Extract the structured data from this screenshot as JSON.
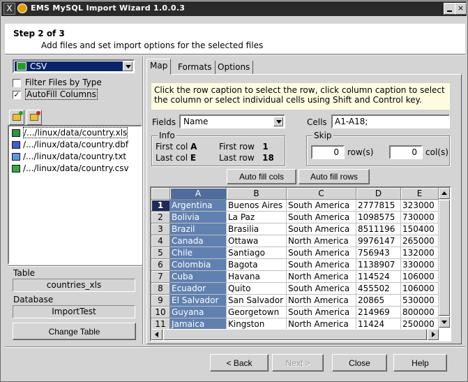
{
  "window": {
    "title": "EMS MySQL Import Wizard 1.0.0.3",
    "close_glyph": "×",
    "x_glyph": "X"
  },
  "header": {
    "step": "Step 2 of 3",
    "description": "Add files and set import options for the selected files"
  },
  "left": {
    "file_type": {
      "selected": "CSV"
    },
    "filter_files_by_type": {
      "label": "Filter Files by Type",
      "checked": false
    },
    "autofill_columns": {
      "label": "AutoFill Columns",
      "checked": true,
      "check_glyph": "✓"
    },
    "files": [
      {
        "name": "/.../linux/data/country.xls",
        "icon": "excel-file-icon",
        "selected": true
      },
      {
        "name": "/.../linux/data/country.dbf",
        "icon": "dbf-file-icon",
        "selected": false
      },
      {
        "name": "/.../linux/data/country.txt",
        "icon": "text-file-icon",
        "selected": false
      },
      {
        "name": "/.../linux/data/country.csv",
        "icon": "csv-file-icon",
        "selected": false
      }
    ],
    "table_label": "Table",
    "table_value": "countries_xls",
    "database_label": "Database",
    "database_value": "ImportTest",
    "change_table_button": "Change Table"
  },
  "tabs": [
    {
      "label": "Map",
      "active": true
    },
    {
      "label": "Formats",
      "active": false
    },
    {
      "label": "Options",
      "active": false
    }
  ],
  "map": {
    "hint_line1": "Click the row caption to select the row, click column caption to select",
    "hint_line2": "the column or select individual cells using Shift and Control key.",
    "fields_label": "Fields",
    "fields_value": "Name",
    "cells_label": "Cells",
    "cells_value": "A1-A18;",
    "info": {
      "title": "Info",
      "first_col_label": "First col",
      "first_col_value": "A",
      "last_col_label": "Last col",
      "last_col_value": "E",
      "first_row_label": "First row",
      "first_row_value": "1",
      "last_row_label": "Last row",
      "last_row_value": "18"
    },
    "skip": {
      "title": "Skip",
      "rows_value": "0",
      "rows_label": "row(s)",
      "cols_value": "0",
      "cols_label": "col(s)"
    },
    "auto_fill_cols_button": "Auto fill cols",
    "auto_fill_rows_button": "Auto fill rows"
  },
  "grid": {
    "columns": [
      "A",
      "B",
      "C",
      "D",
      "E"
    ],
    "selected_column": "A",
    "rows": [
      [
        "1",
        "Argentina",
        "Buenos Aires",
        "South America",
        "2777815",
        "323000"
      ],
      [
        "2",
        "Bolivia",
        "La Paz",
        "South America",
        "1098575",
        "730000"
      ],
      [
        "3",
        "Brazil",
        "Brasilia",
        "South America",
        "8511196",
        "150400"
      ],
      [
        "4",
        "Canada",
        "Ottawa",
        "North America",
        "9976147",
        "265000"
      ],
      [
        "5",
        "Chile",
        "Santiago",
        "South America",
        "756943",
        "132000"
      ],
      [
        "6",
        "Colombia",
        "Bagota",
        "South America",
        "1138907",
        "330000"
      ],
      [
        "7",
        "Cuba",
        "Havana",
        "North America",
        "114524",
        "106000"
      ],
      [
        "8",
        "Ecuador",
        "Quito",
        "South America",
        "455502",
        "106000"
      ],
      [
        "9",
        "El Salvador",
        "San Salvador",
        "North America",
        "20865",
        "530000"
      ],
      [
        "10",
        "Guyana",
        "Georgetown",
        "South America",
        "214969",
        "800000"
      ],
      [
        "11",
        "Jamaica",
        "Kingston",
        "North America",
        "11424",
        "250000"
      ]
    ]
  },
  "footer": {
    "back_button": "< Back",
    "next_button": "Next >",
    "close_button": "Close",
    "help_button": "Help"
  }
}
